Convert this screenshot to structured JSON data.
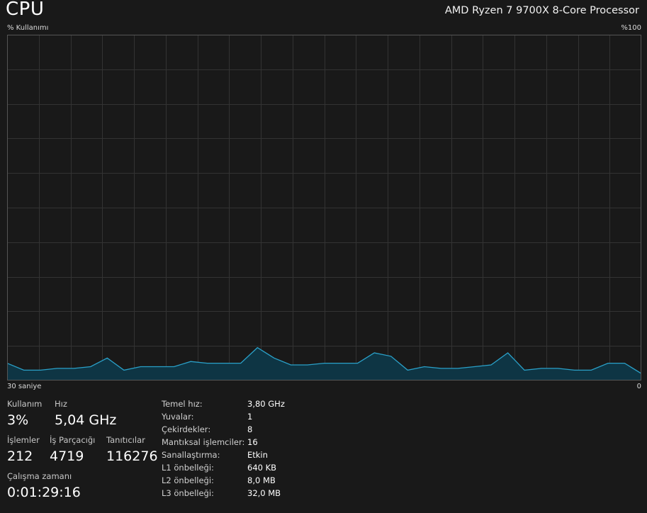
{
  "header": {
    "title": "CPU",
    "processor": "AMD Ryzen 7 9700X 8-Core Processor"
  },
  "graph": {
    "y_label": "% Kullanımı",
    "y_max_label": "%100",
    "x_label": "30 saniye",
    "x_min_label": "0",
    "line_color": "#2aa0c8",
    "fill_color": "#0e3544",
    "grid_color": "#333333",
    "usage_percent": [
      5,
      3,
      3,
      3.5,
      3.5,
      4,
      6.5,
      3,
      4,
      4,
      4,
      5.5,
      5,
      5,
      5,
      9.5,
      6.5,
      4.5,
      4.5,
      5,
      5,
      5,
      8,
      7,
      3,
      4,
      3.5,
      3.5,
      4,
      4.5,
      8,
      3,
      3.5,
      3.5,
      3,
      3,
      5,
      5,
      2
    ]
  },
  "stats": {
    "utilization": {
      "label": "Kullanım",
      "value": "3%"
    },
    "speed": {
      "label": "Hız",
      "value": "5,04 GHz"
    },
    "processes": {
      "label": "İşlemler",
      "value": "212"
    },
    "threads": {
      "label": "İş Parçacığı",
      "value": "4719"
    },
    "handles": {
      "label": "Tanıtıcılar",
      "value": "116276"
    },
    "uptime": {
      "label": "Çalışma zamanı",
      "value": "0:01:29:16"
    }
  },
  "specs": [
    {
      "label": "Temel hız:",
      "value": "3,80 GHz"
    },
    {
      "label": "Yuvalar:",
      "value": "1"
    },
    {
      "label": "Çekirdekler:",
      "value": "8"
    },
    {
      "label": "Mantıksal işlemciler:",
      "value": "16"
    },
    {
      "label": "Sanallaştırma:",
      "value": "Etkin"
    },
    {
      "label": "L1 önbelleği:",
      "value": "640 KB"
    },
    {
      "label": "L2 önbelleği:",
      "value": "8,0 MB"
    },
    {
      "label": "L3 önbelleği:",
      "value": "32,0 MB"
    }
  ]
}
